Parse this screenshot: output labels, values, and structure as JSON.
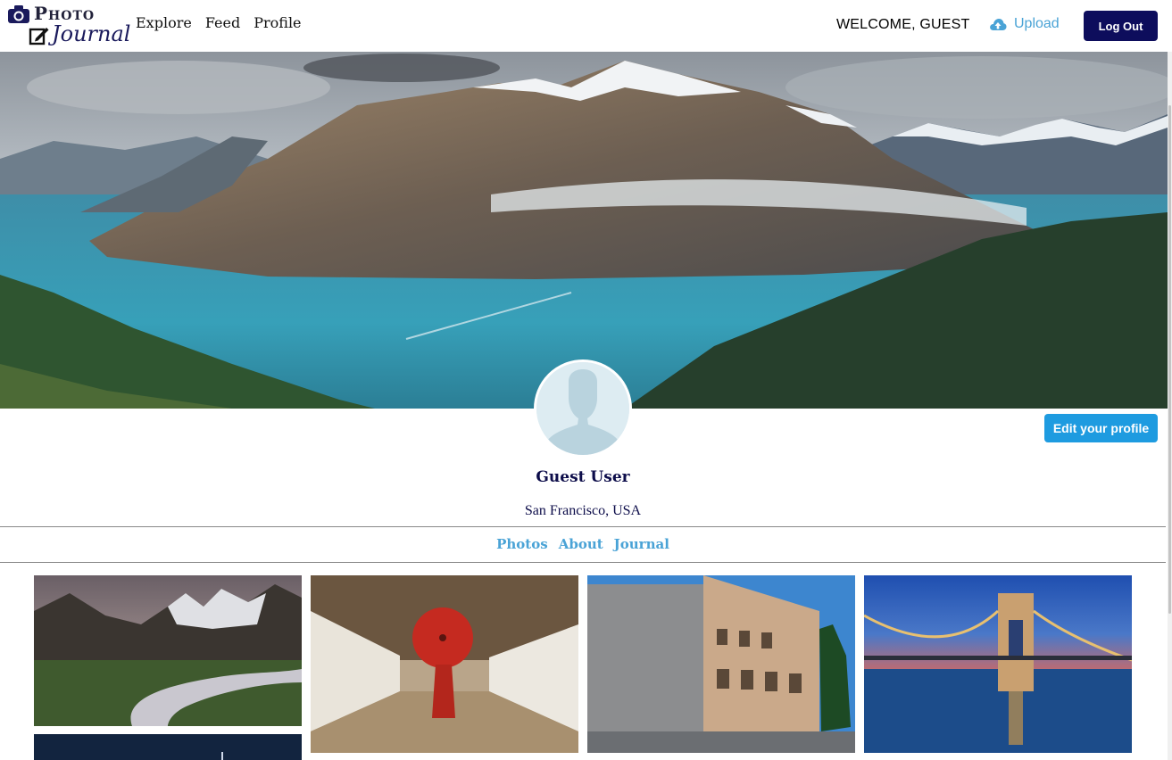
{
  "header": {
    "logo_top": "Photo",
    "logo_bottom": "Journal",
    "nav": [
      "Explore",
      "Feed",
      "Profile"
    ],
    "welcome": "WELCOME, GUEST",
    "upload_label": "Upload",
    "logout_label": "Log Out"
  },
  "profile": {
    "edit_label": "Edit your profile",
    "name": "Guest User",
    "location": "San Francisco, USA",
    "tabs": [
      "Photos",
      "About",
      "Journal"
    ]
  },
  "colors": {
    "brand_navy": "#0d0d5c",
    "accent_blue": "#1e9be0",
    "link_blue": "#4aa3d6"
  },
  "photos": [
    "mountain-river-landscape",
    "monk-red-umbrella-corridor",
    "colosseum-rome",
    "chain-bridge-budapest-night",
    "night-sky"
  ]
}
